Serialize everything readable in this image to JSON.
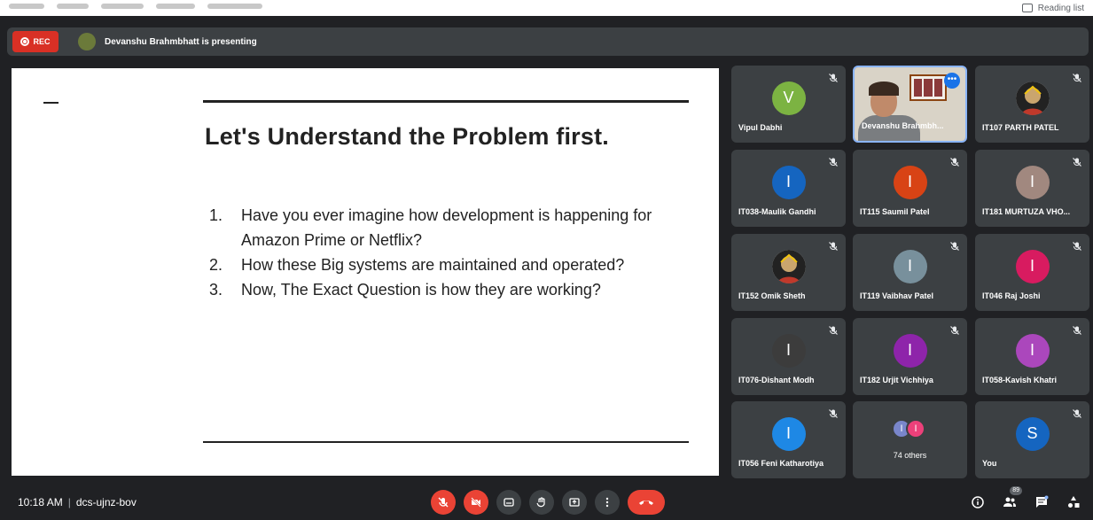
{
  "browser": {
    "reading_list_label": "Reading list"
  },
  "top_bar": {
    "rec_label": "REC",
    "presenting_text": "Devanshu Brahmbhatt is presenting"
  },
  "slide": {
    "title": "Let's Understand the Problem first.",
    "items": [
      {
        "num": "1.",
        "text": "Have you ever imagine how development is happening for Amazon Prime or Netflix?"
      },
      {
        "num": "2.",
        "text": "How these Big systems are maintained and operated?"
      },
      {
        "num": "3.",
        "text": "Now, The Exact Question is how they are working?"
      }
    ]
  },
  "participants": [
    {
      "name": "Vipul Dabhi",
      "initial": "V",
      "color": "#7cb342"
    },
    {
      "name": "Devanshu Brahmbh...",
      "video": true
    },
    {
      "name": "IT107 PARTH PATEL",
      "image": true
    },
    {
      "name": "IT038-Maulik Gandhi",
      "initial": "I",
      "color": "#1565c0"
    },
    {
      "name": "IT115 Saumil Patel",
      "initial": "I",
      "color": "#d84315"
    },
    {
      "name": "IT181 MURTUZA VHO...",
      "initial": "I",
      "color": "#a1887f"
    },
    {
      "name": "IT152 Omik Sheth",
      "image": true
    },
    {
      "name": "IT119 Vaibhav Patel",
      "initial": "I",
      "color": "#78909c"
    },
    {
      "name": "IT046 Raj Joshi",
      "initial": "I",
      "color": "#d81b60"
    },
    {
      "name": "IT076-Dishant Modh",
      "initial": "I",
      "color": "#3c3c3c"
    },
    {
      "name": "IT182 Urjit Vichhiya",
      "initial": "I",
      "color": "#8e24aa"
    },
    {
      "name": "IT058-Kavish Khatri",
      "initial": "I",
      "color": "#ab47bc"
    },
    {
      "name": "IT056 Feni Katharotiya",
      "initial": "I",
      "color": "#1e88e5"
    },
    {
      "name": "74 others",
      "others": true,
      "initials": [
        "I",
        "I"
      ],
      "colors": [
        "#7986cb",
        "#ec407a"
      ]
    },
    {
      "name": "You",
      "initial": "S",
      "color": "#1565c0"
    }
  ],
  "bottom_bar": {
    "time": "10:18 AM",
    "meeting_code": "dcs-ujnz-bov",
    "people_badge": "89"
  },
  "colors": {
    "end_call": "#ea4335",
    "tile_bg": "#3c4043",
    "bg": "#202124"
  }
}
